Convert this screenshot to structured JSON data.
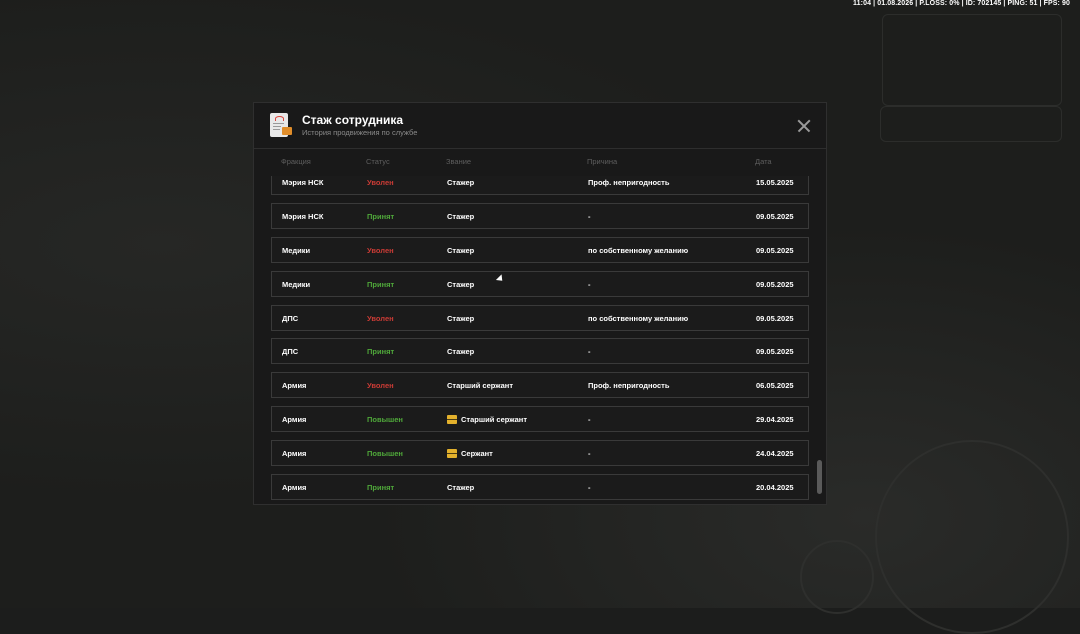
{
  "hud": {
    "status_line": "11:04 | 01.08.2026 | P.LOSS: 0% | ID: 702145 | PING: 51 | FPS: 90"
  },
  "modal": {
    "title": "Стаж сотрудника",
    "subtitle": "История продвижения по службе",
    "icon": "document-icon",
    "close_icon": "close-icon"
  },
  "table": {
    "headers": {
      "faction": "Фракция",
      "status": "Статус",
      "rank": "Звание",
      "reason": "Причина",
      "date": "Дата"
    },
    "rows": [
      {
        "faction": "Мэрия НСК",
        "status": "Уволен",
        "rank": "Стажер",
        "reason": "Проф. непригодность",
        "date": "15.05.2025"
      },
      {
        "faction": "Мэрия НСК",
        "status": "Принят",
        "rank": "Стажер",
        "reason": "-",
        "date": "09.05.2025"
      },
      {
        "faction": "Медики",
        "status": "Уволен",
        "rank": "Стажер",
        "reason": "по собственному желанию",
        "date": "09.05.2025"
      },
      {
        "faction": "Медики",
        "status": "Принят",
        "rank": "Стажер",
        "reason": "-",
        "date": "09.05.2025"
      },
      {
        "faction": "ДПС",
        "status": "Уволен",
        "rank": "Стажер",
        "reason": "по собственному желанию",
        "date": "09.05.2025"
      },
      {
        "faction": "ДПС",
        "status": "Принят",
        "rank": "Стажер",
        "reason": "-",
        "date": "09.05.2025"
      },
      {
        "faction": "Армия",
        "status": "Уволен",
        "rank": "Старший сержант",
        "reason": "Проф. непригодность",
        "date": "06.05.2025"
      },
      {
        "faction": "Армия",
        "status": "Повышен",
        "rank": "Старший сержант",
        "reason": "-",
        "date": "29.04.2025"
      },
      {
        "faction": "Армия",
        "status": "Повышен",
        "rank": "Сержант",
        "reason": "-",
        "date": "24.04.2025"
      },
      {
        "faction": "Армия",
        "status": "Принят",
        "rank": "Стажер",
        "reason": "-",
        "date": "20.04.2025"
      }
    ]
  },
  "colors": {
    "fired": "#c93b35",
    "hired": "#4fa83a",
    "promoted": "#4fa83a"
  }
}
